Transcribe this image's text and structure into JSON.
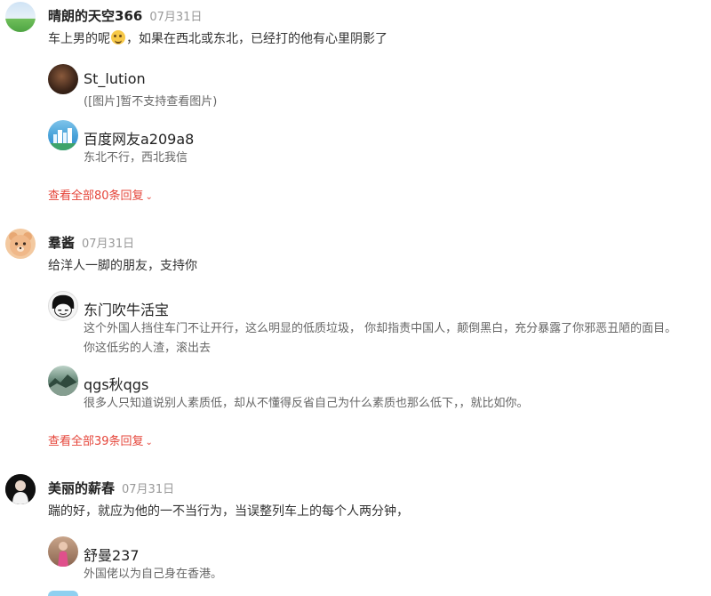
{
  "comments": [
    {
      "user": "晴朗的天空366",
      "date": "07月31日",
      "text_before_emoji": "车上男的呢",
      "emoji": "grinning-sweat-emoji",
      "text_after_emoji": "，如果在西北或东北，已经打的他有心里阴影了",
      "replies": [
        {
          "user": "St_lution",
          "text": "([图片]暂不支持查看图片)"
        },
        {
          "user": "百度网友a209a8",
          "text": "东北不行，西北我信"
        }
      ],
      "more": "查看全部80条回复"
    },
    {
      "user": "羣酱",
      "date": "07月31日",
      "text": "给洋人一脚的朋友，支持你",
      "replies": [
        {
          "user": "东门吹牛活宝",
          "text_line1": "这个外国人挡住车门不让开行，这么明显的低质垃圾， 你却指责中国人，颠倒黑白，充分暴露了你邪恶丑陋的面目。",
          "text_line2": "你这低劣的人渣，滚出去"
        },
        {
          "user": "qgs秋qgs",
          "text": "很多人只知道说别人素质低，却从不懂得反省自己为什么素质也那么低下，，就比如你。"
        }
      ],
      "more": "查看全部39条回复"
    },
    {
      "user": "美丽的薪春",
      "date": "07月31日",
      "text": "踹的好，就应为他的一不当行为，当误整列车上的每个人两分钟，",
      "replies": [
        {
          "user": "舒曼237",
          "text": "外国佬以为自己身在香港。"
        }
      ]
    }
  ],
  "colors": {
    "accent": "#e5453a",
    "muted": "#999999"
  }
}
